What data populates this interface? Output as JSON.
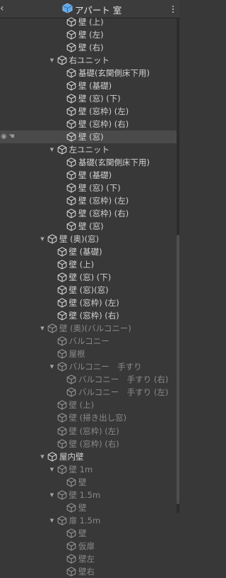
{
  "header": {
    "back_icon": "chevron-left-icon",
    "title": "アパート 室",
    "title_icon": "prefab-cube-icon",
    "accent": "#5fa8e8",
    "menu_icon": "more-vertical-icon"
  },
  "colors": {
    "background": "#383838",
    "selected_row": "#4a4a4a",
    "text": "#d2d2d2",
    "dim_text": "#8a8a8a"
  },
  "tree": [
    {
      "label": "壁 (上)",
      "depth": 2,
      "arrow": "none"
    },
    {
      "label": "壁 (左)",
      "depth": 2,
      "arrow": "none"
    },
    {
      "label": "壁 (右)",
      "depth": 2,
      "arrow": "none"
    },
    {
      "label": "右ユニット",
      "depth": 1,
      "arrow": "down"
    },
    {
      "label": "基礎(玄関側床下用)",
      "depth": 2,
      "arrow": "none"
    },
    {
      "label": "壁 (基礎)",
      "depth": 2,
      "arrow": "none"
    },
    {
      "label": "壁 (窓) (下)",
      "depth": 2,
      "arrow": "none"
    },
    {
      "label": "壁 (窓枠) (左)",
      "depth": 2,
      "arrow": "none"
    },
    {
      "label": "壁 (窓枠) (右)",
      "depth": 2,
      "arrow": "none"
    },
    {
      "label": "壁 (窓)",
      "depth": 2,
      "arrow": "none",
      "selected": true,
      "visibility_icons": true
    },
    {
      "label": "左ユニット",
      "depth": 1,
      "arrow": "down"
    },
    {
      "label": "基礎(玄関側床下用)",
      "depth": 2,
      "arrow": "none"
    },
    {
      "label": "壁 (基礎)",
      "depth": 2,
      "arrow": "none"
    },
    {
      "label": "壁 (窓) (下)",
      "depth": 2,
      "arrow": "none"
    },
    {
      "label": "壁 (窓枠) (左)",
      "depth": 2,
      "arrow": "none"
    },
    {
      "label": "壁 (窓枠) (右)",
      "depth": 2,
      "arrow": "none"
    },
    {
      "label": "壁 (窓)",
      "depth": 2,
      "arrow": "none"
    },
    {
      "label": "壁 (奥)(窓)",
      "depth": 0,
      "arrow": "down"
    },
    {
      "label": "壁 (基礎)",
      "depth": 1,
      "arrow": "none"
    },
    {
      "label": "壁 (上)",
      "depth": 1,
      "arrow": "none"
    },
    {
      "label": "壁 (窓) (下)",
      "depth": 1,
      "arrow": "none"
    },
    {
      "label": "壁 (窓)(窓)",
      "depth": 1,
      "arrow": "none"
    },
    {
      "label": "壁 (窓枠) (左)",
      "depth": 1,
      "arrow": "none"
    },
    {
      "label": "壁 (窓枠) (右)",
      "depth": 1,
      "arrow": "none"
    },
    {
      "label": "壁 (奥)(バルコニー)",
      "depth": 0,
      "arrow": "down",
      "dim": true
    },
    {
      "label": "バルコニー",
      "depth": 1,
      "arrow": "none",
      "dim": true
    },
    {
      "label": "屋根",
      "depth": 1,
      "arrow": "none",
      "dim": true
    },
    {
      "label": "バルコニー　手すり",
      "depth": 1,
      "arrow": "down",
      "dim": true
    },
    {
      "label": "バルコニー　手すり (右)",
      "depth": 2,
      "arrow": "none",
      "dim": true
    },
    {
      "label": "バルコニー　手すり (左)",
      "depth": 2,
      "arrow": "none",
      "dim": true
    },
    {
      "label": "壁 (上)",
      "depth": 1,
      "arrow": "none",
      "dim": true
    },
    {
      "label": "壁 (掃き出し窓)",
      "depth": 1,
      "arrow": "none",
      "dim": true
    },
    {
      "label": "壁 (窓枠) (左)",
      "depth": 1,
      "arrow": "none",
      "dim": true
    },
    {
      "label": "壁 (窓枠) (右)",
      "depth": 1,
      "arrow": "none",
      "dim": true
    },
    {
      "label": "屋内壁",
      "depth": 0,
      "arrow": "down"
    },
    {
      "label": "壁 1m",
      "depth": 1,
      "arrow": "down",
      "dim": true
    },
    {
      "label": "壁",
      "depth": 2,
      "arrow": "none",
      "dim": true
    },
    {
      "label": "壁 1.5m",
      "depth": 1,
      "arrow": "down",
      "dim": true
    },
    {
      "label": "壁",
      "depth": 2,
      "arrow": "none",
      "dim": true
    },
    {
      "label": "扉 1.5m",
      "depth": 1,
      "arrow": "down",
      "dim": true
    },
    {
      "label": "壁",
      "depth": 2,
      "arrow": "none",
      "dim": true
    },
    {
      "label": "仮扉",
      "depth": 2,
      "arrow": "none",
      "dim": true
    },
    {
      "label": "壁左",
      "depth": 2,
      "arrow": "none",
      "dim": true
    },
    {
      "label": "壁右",
      "depth": 2,
      "arrow": "none",
      "dim": true
    }
  ]
}
